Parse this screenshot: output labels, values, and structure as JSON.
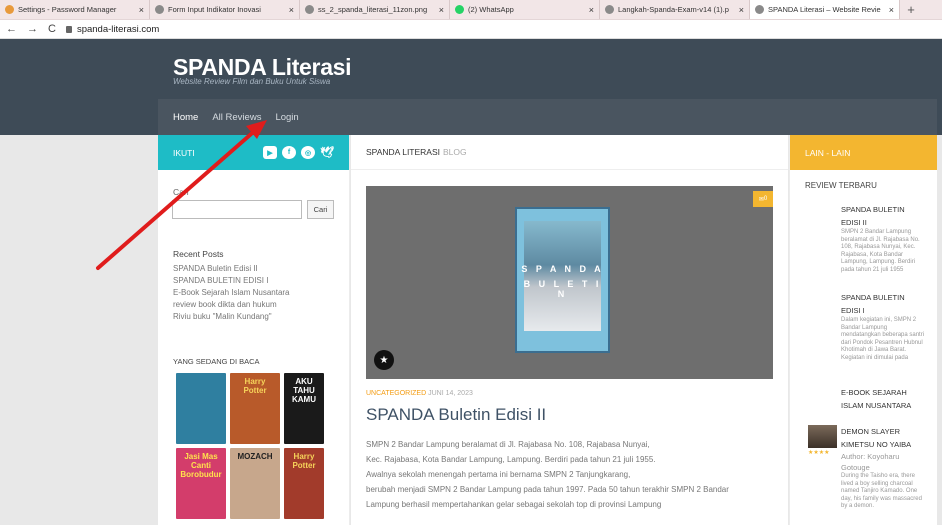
{
  "browser": {
    "tabs": [
      {
        "title": "Settings - Password Manager",
        "color": "#e89a3c",
        "active": false
      },
      {
        "title": "Form Input Indikator Inovasi",
        "color": "#8a8a8a",
        "active": false
      },
      {
        "title": "ss_2_spanda_literasi_11zon.png",
        "color": "#8a8a8a",
        "active": false
      },
      {
        "title": "(2) WhatsApp",
        "color": "#25d366",
        "active": false
      },
      {
        "title": "Langkah-Spanda-Exam-v14 (1).p",
        "color": "#8a8a8a",
        "active": false
      },
      {
        "title": "SPANDA Literasi – Website Revie",
        "color": "#8a8a8a",
        "active": true
      }
    ],
    "url": "spanda-literasi.com"
  },
  "site": {
    "title": "SPANDA Literasi",
    "tagline": "Website Review Film dan Buku Untuk Siswa"
  },
  "menu": {
    "home": "Home",
    "all_reviews": "All Reviews",
    "login": "Login"
  },
  "sidebar_left": {
    "ikuti": "IKUTI",
    "search_label": "Cari",
    "search_button": "Cari",
    "recent_title": "Recent Posts",
    "recent_posts": [
      "SPANDA Buletin Edisi II",
      "SPANDA BULETIN EDISI I",
      "E-Book Sejarah Islam Nusantara",
      "review book dikta dan hukum",
      "Riviu buku \"Malin Kundang\""
    ],
    "reading_title": "YANG SEDANG DI BACA",
    "books": [
      {
        "label": "",
        "color": "#2f7fa0"
      },
      {
        "label": "Harry Potter",
        "color": "#b85a2a"
      },
      {
        "label": "AKU TAHU KAMU",
        "color": "#1a1a1a"
      },
      {
        "label": "Jasi Mas Canti Borobudur",
        "color": "#d33d6b"
      },
      {
        "label": "MOZACH",
        "color": "#c7a78c"
      },
      {
        "label": "Harry Potter",
        "color": "#a23b2b"
      }
    ]
  },
  "main": {
    "heading": "SPANDA LITERASI",
    "heading_sub": "BLOG",
    "comments": "0",
    "cover_line1": "S P A N D A",
    "cover_line2": "B U L E T I N",
    "category": "UNCATEGORIZED",
    "date": "JUNI 14, 2023",
    "post_title": "SPANDA Buletin Edisi II",
    "excerpt": [
      "SMPN 2 Bandar Lampung beralamat di Jl. Rajabasa No. 108, Rajabasa Nunyai,",
      "Kec. Rajabasa, Kota Bandar Lampung, Lampung. Berdiri pada tahun 21 juli 1955.",
      "Awalnya sekolah menengah pertama ini bernama SMPN 2 Tanjungkarang,",
      "berubah menjadi SMPN 2 Bandar Lampung pada tahun 1997. Pada 50 tahun terakhir SMPN 2 Bandar",
      "Lampung berhasil mempertahankan gelar sebagai sekolah top di provinsi Lampung"
    ]
  },
  "sidebar_right": {
    "heading": "LAIN - LAIN",
    "review_title": "REVIEW TERBARU",
    "reviews": [
      {
        "title": "SPANDA BULETIN EDISI II",
        "text": "SMPN 2 Bandar Lampung beralamat di Jl. Rajabasa No. 108, Rajabasa Nunyai, Kec. Rajabasa, Kota Bandar Lampung, Lampung. Berdiri pada tahun 21 juli 1955"
      },
      {
        "title": "SPANDA BULETIN EDISI I",
        "text": "Dalam kegiatan ini, SMPN 2 Bandar Lampung mendatangkan beberapa santri dari Pondok Pesantren Hubnul Khotimah di Jawa Barat. Kegiatan ini dimulai pada"
      },
      {
        "title": "E-BOOK SEJARAH ISLAM NUSANTARA",
        "text": ""
      },
      {
        "title": "DEMON SLAYER KIMETSU NO YAIBA",
        "text": "Author: Koyoharu Gotouge",
        "extra": "During the Taisho era, there lived a boy selling charcoal named Tanjiro Kamado. One day, his family was massacred by a demon."
      }
    ]
  }
}
